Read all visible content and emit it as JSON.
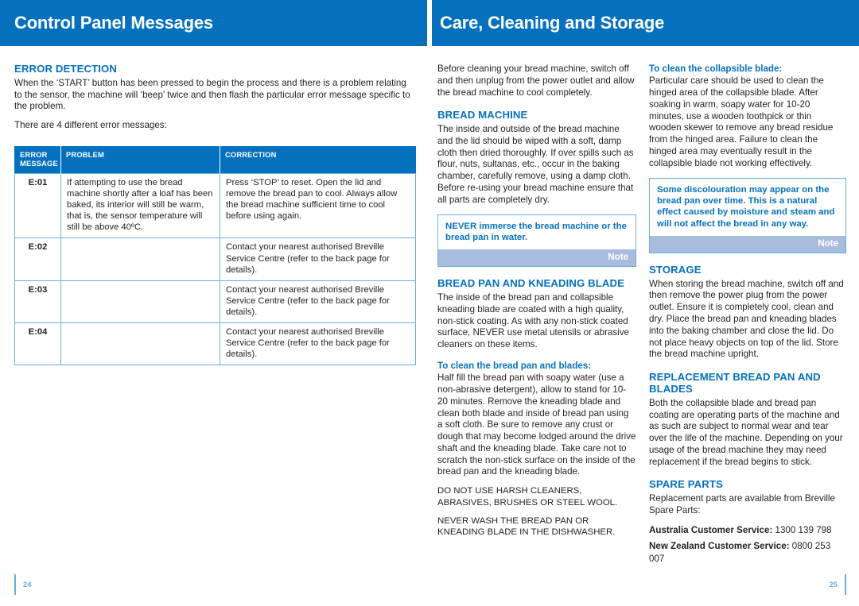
{
  "left_page": {
    "header_title": "Control Panel Messages",
    "page_number": "24",
    "section_title": "ERROR DETECTION",
    "intro_para_1": "When the ‘START’ button has been pressed to begin the process and there is a problem relating to the sensor, the machine will ‘beep’ twice and then flash the particular error message specific to the problem.",
    "intro_para_2": "There are 4 different error messages:",
    "table": {
      "headers": [
        "ERROR MESSAGE",
        "PROBLEM",
        "CORRECTION"
      ],
      "header_line_1": "ERROR",
      "header_line_2": "MESSAGE",
      "rows": [
        {
          "code": "E:01",
          "problem": "If attempting to use the bread machine shortly after a loaf has been baked, its interior will still be warm, that is, the sensor temperature will still be above 40ºC.",
          "correction": "Press ‘STOP’ to reset. Open the lid and remove the bread pan to cool. Always allow the bread machine sufficient time to cool before using again."
        },
        {
          "code": "E:02",
          "problem": "",
          "correction": "Contact your nearest authorised Breville Service Centre (refer to the back page for details)."
        },
        {
          "code": "E:03",
          "problem": "",
          "correction": "Contact your nearest authorised Breville Service Centre (refer to the back page for details)."
        },
        {
          "code": "E:04",
          "problem": "",
          "correction": "Contact your nearest authorised Breville Service Centre (refer to the back page for details)."
        }
      ]
    }
  },
  "right_page": {
    "header_title": "Care, Cleaning and Storage",
    "page_number": "25",
    "middle_column": {
      "intro": "Before cleaning your bread machine, switch off and then unplug from the power outlet and allow the bread machine to cool completely.",
      "bread_machine_title": "BREAD MACHINE",
      "bread_machine_body": "The inside and outside of the bread machine and the lid should be wiped with a soft, damp cloth then dried thoroughly. If over spills such as flour, nuts, sultanas, etc., occur in the baking chamber, carefully remove, using a damp cloth. Before re-using your bread machine ensure that all parts are completely dry.",
      "note_1_text": "NEVER immerse the bread machine or the bread pan in water.",
      "note_1_label": "Note",
      "bread_pan_title": "BREAD PAN AND KNEADING BLADE",
      "bread_pan_body": "The inside of the bread pan and collapsible kneading blade are coated with a high quality, non-stick coating. As with any non-stick coated surface, NEVER use metal utensils or abrasive cleaners on these items.",
      "clean_pan_subtitle": "To clean the bread pan and blades:",
      "clean_pan_body": "Half fill the bread pan with soapy water (use a non-abrasive detergent), allow to stand for 10-20 minutes. Remove the kneading blade and clean both blade and inside of bread pan using a soft cloth. Be sure to remove any crust or dough that may become lodged around the drive shaft and the kneading blade. Take care not to scratch the non-stick surface on the inside of the bread pan and the kneading blade.",
      "caution_1": "DO NOT USE HARSH CLEANERS, ABRASIVES, BRUSHES OR STEEL WOOL.",
      "caution_2": "NEVER WASH THE BREAD PAN OR KNEADING BLADE IN THE DISHWASHER."
    },
    "right_column": {
      "collapsible_subtitle": "To clean the collapsible blade:",
      "collapsible_body": "Particular care should be used to clean the hinged area of the collapsible blade. After soaking in warm, soapy water for 10-20 minutes, use a wooden toothpick or thin wooden skewer to remove any bread residue from the hinged area. Failure to clean the hinged area may eventually result in the collapsible blade not working effectively.",
      "note_2_text": "Some discolouration may appear on the bread pan over time. This is a natural effect caused by moisture and steam and will not affect the bread in any way.",
      "note_2_label": "Note",
      "storage_title": "STORAGE",
      "storage_body": "When storing the bread machine, switch off and then remove the power plug from the power outlet. Ensure it is completely cool, clean and dry. Place the bread pan and kneading blades into the baking chamber and close the lid. Do not place heavy objects on top of the lid. Store the bread machine upright.",
      "replacement_title": "REPLACEMENT BREAD PAN AND BLADES",
      "replacement_body": "Both the collapsible blade and bread pan coating are operating parts of the machine and as such are subject to normal wear and tear over the life of the machine. Depending on your usage of the bread machine they may need replacement if the bread begins to stick.",
      "spare_parts_title": "SPARE PARTS",
      "spare_parts_body": "Replacement parts are available from Breville Spare Parts:",
      "au_label": "Australia Customer Service:",
      "au_number": "1300 139 798",
      "nz_label": "New Zealand Customer Service:",
      "nz_number": "0800 253 007"
    }
  },
  "colors": {
    "brand_blue": "#0571be",
    "light_blue_rule": "#6aaedd",
    "note_footer": "#a8bdde",
    "body_text": "#231f20"
  }
}
